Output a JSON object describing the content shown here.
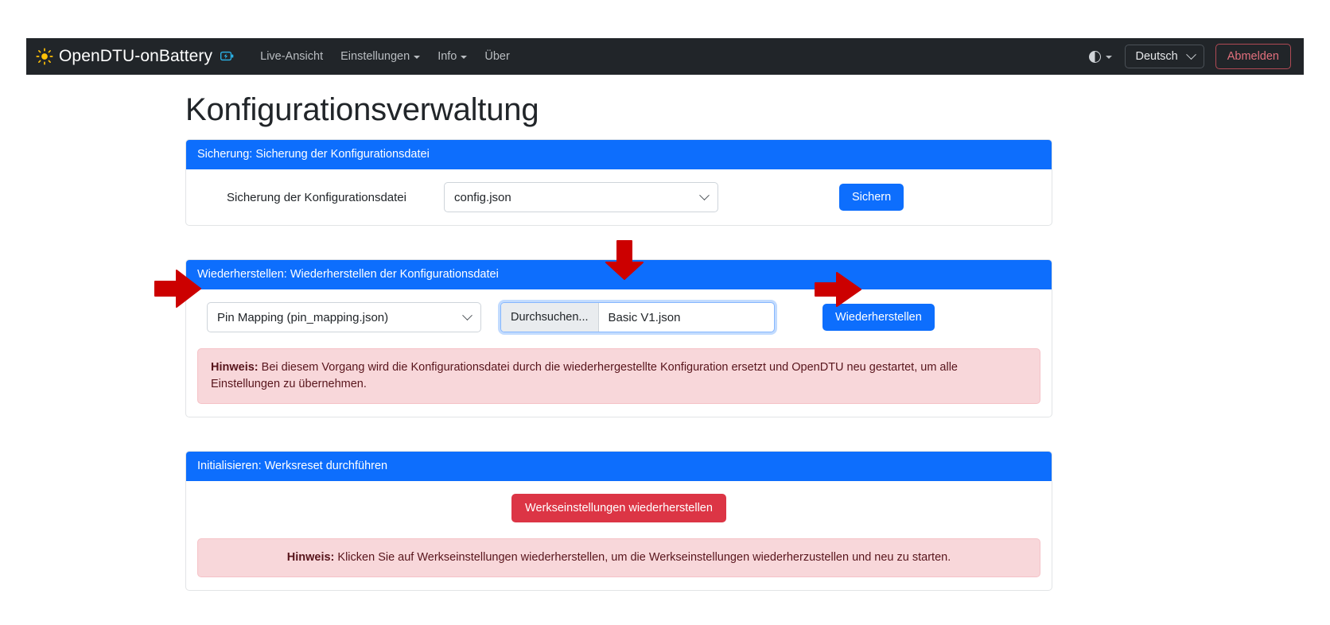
{
  "navbar": {
    "brand": "OpenDTU-onBattery",
    "brand_icon": "sun-icon",
    "brand_badge_icon": "battery-bolt-icon",
    "links": [
      {
        "label": "Live-Ansicht",
        "has_dropdown": false
      },
      {
        "label": "Einstellungen",
        "has_dropdown": true
      },
      {
        "label": "Info",
        "has_dropdown": true
      },
      {
        "label": "Über",
        "has_dropdown": false
      }
    ],
    "theme_toggle_icon": "half-circle-contrast-icon",
    "language": "Deutsch",
    "logout_label": "Abmelden"
  },
  "page": {
    "title": "Konfigurationsverwaltung"
  },
  "backup_card": {
    "header": "Sicherung: Sicherung der Konfigurationsdatei",
    "field_label": "Sicherung der Konfigurationsdatei",
    "select_value": "config.json",
    "submit_label": "Sichern"
  },
  "restore_card": {
    "header": "Wiederherstellen: Wiederherstellen der Konfigurationsdatei",
    "select_value": "Pin Mapping (pin_mapping.json)",
    "file_button_label": "Durchsuchen...",
    "file_name": "Basic V1.json",
    "submit_label": "Wiederherstellen",
    "notice_strong": "Hinweis:",
    "notice_text": " Bei diesem Vorgang wird die Konfigurationsdatei durch die wiederhergestellte Konfiguration ersetzt und OpenDTU neu gestartet, um alle Einstellungen zu übernehmen."
  },
  "reset_card": {
    "header": "Initialisieren: Werksreset durchführen",
    "button_label": "Werkseinstellungen wiederherstellen",
    "notice_strong": "Hinweis:",
    "notice_text": " Klicken Sie auf Werkseinstellungen wiederherstellen, um die Werkseinstellungen wiederherzustellen und neu zu starten."
  },
  "colors": {
    "navbar_bg": "#212529",
    "primary": "#0d6efd",
    "danger": "#dc3545",
    "alert_bg": "#f8d7da",
    "annotation": "#cc0000"
  }
}
